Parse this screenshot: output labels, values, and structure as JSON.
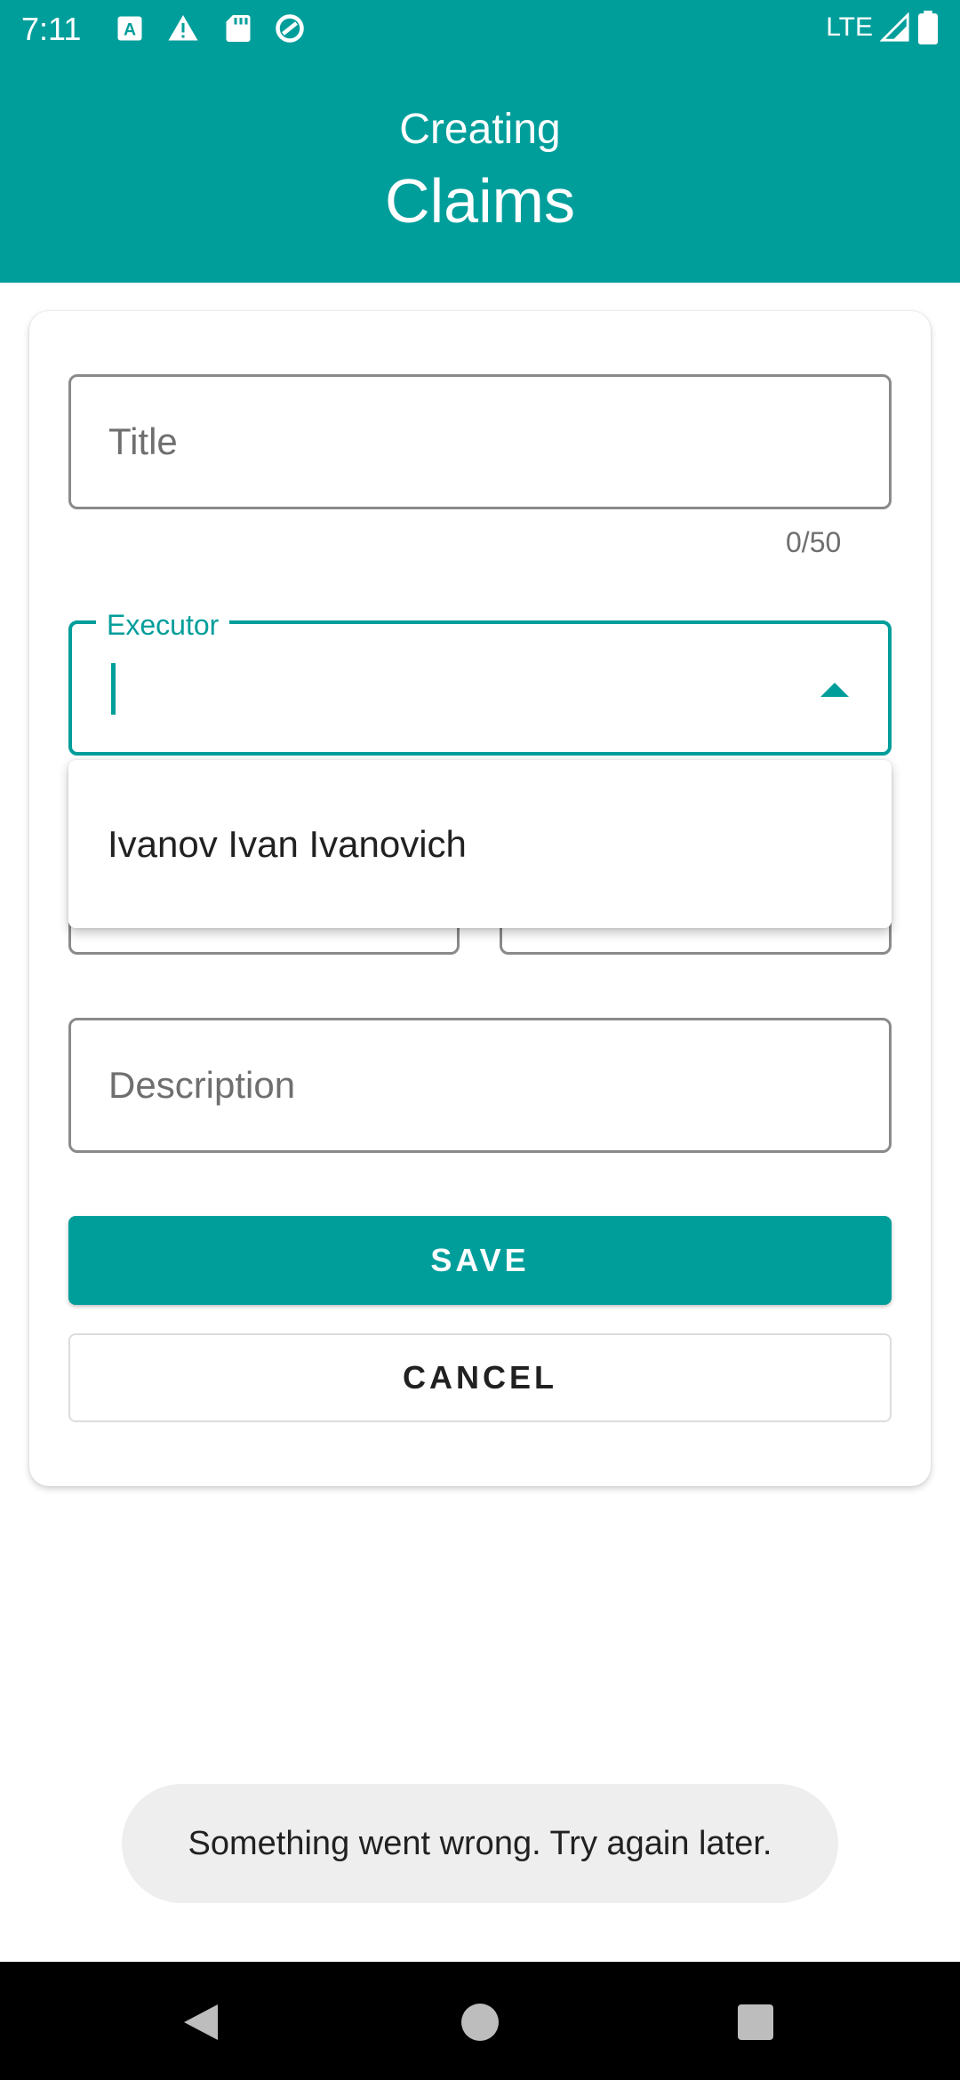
{
  "status_bar": {
    "time": "7:11",
    "network": "LTE",
    "icons": [
      "keyboard-a-icon",
      "warning-icon",
      "sd-card-icon",
      "sync-circle-icon",
      "signal-icon",
      "battery-icon"
    ]
  },
  "header": {
    "subtitle": "Creating",
    "title": "Claims"
  },
  "form": {
    "title_field": {
      "placeholder": "Title",
      "value": "",
      "counter": "0/50"
    },
    "executor_field": {
      "label": "Executor",
      "value": ""
    },
    "executor_dropdown": {
      "options": [
        "Ivanov Ivan Ivanovich"
      ]
    },
    "description_field": {
      "placeholder": "Description",
      "value": ""
    },
    "save_label": "SAVE",
    "cancel_label": "CANCEL"
  },
  "toast": {
    "message": "Something went wrong. Try again later."
  },
  "colors": {
    "primary": "#009e9b",
    "toast_bg": "#eeeeee",
    "nav_bg": "#000000"
  }
}
